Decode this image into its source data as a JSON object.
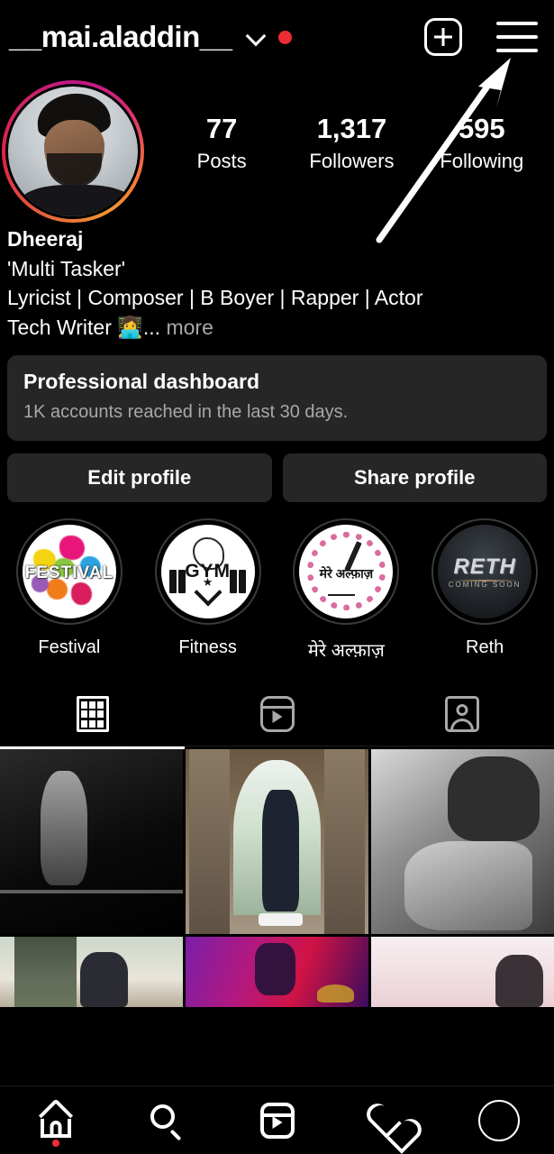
{
  "header": {
    "username": "__mai.aladdin__",
    "chevron_icon": "chevron-down-icon",
    "status_dot_color": "#ed2d35",
    "new_post_icon": "plus-square-icon",
    "menu_icon": "hamburger-menu-icon"
  },
  "profile": {
    "avatar_alt": "profile-photo",
    "has_story_ring": true,
    "story_ring_colors": [
      "#f09433",
      "#dc2743",
      "#bc1888"
    ],
    "stats": [
      {
        "value": "77",
        "label": "Posts"
      },
      {
        "value": "1,317",
        "label": "Followers"
      },
      {
        "value": "595",
        "label": "Following"
      }
    ],
    "bio": {
      "name": "Dheeraj",
      "line1": "'Multi Tasker'",
      "line2": "Lyricist  | Composer | B Boyer | Rapper | Actor",
      "line3": "Tech Writer 👩‍💻...",
      "more": "more"
    }
  },
  "dashboard": {
    "title": "Professional dashboard",
    "subtitle": "1K accounts reached in the last 30 days."
  },
  "actions": {
    "edit_profile": "Edit profile",
    "share_profile": "Share profile"
  },
  "highlights": [
    {
      "label": "Festival",
      "cover": "festival-paint-splatter",
      "cover_text": "FESTIVAL"
    },
    {
      "label": "Fitness",
      "cover": "gym-logo",
      "cover_text": "GYM"
    },
    {
      "label": "मेरे अल्फ़ाज़",
      "cover": "pink-wreath-pen",
      "cover_text": "मेरे अल्फ़ाज़"
    },
    {
      "label": "Reth",
      "cover": "reth-dark-logo",
      "cover_text": "RETH",
      "cover_subtext": "COMING SOON"
    }
  ],
  "tabs": [
    {
      "name": "grid",
      "icon": "grid-icon",
      "active": true
    },
    {
      "name": "reels",
      "icon": "reels-icon",
      "active": false
    },
    {
      "name": "tagged",
      "icon": "tagged-person-icon",
      "active": false
    }
  ],
  "posts": [
    {
      "alt": "black-and-white-gym-performance"
    },
    {
      "alt": "man-standing-in-archway"
    },
    {
      "alt": "black-and-white-muscle-flex"
    },
    {
      "alt": "outdoor-portrait-sunglasses"
    },
    {
      "alt": "purple-stage-performance"
    },
    {
      "alt": "pink-sky-portrait"
    }
  ],
  "bottom_nav": [
    {
      "name": "home",
      "icon": "home-icon",
      "badge": true
    },
    {
      "name": "search",
      "icon": "search-icon",
      "badge": false
    },
    {
      "name": "reels",
      "icon": "reels-icon",
      "badge": false
    },
    {
      "name": "activity",
      "icon": "heart-icon",
      "badge": false
    },
    {
      "name": "profile",
      "icon": "profile-avatar-icon",
      "badge": false,
      "active": true
    }
  ],
  "annotation": {
    "type": "arrow",
    "color": "#ffffff",
    "points_to": "hamburger-menu-icon"
  }
}
